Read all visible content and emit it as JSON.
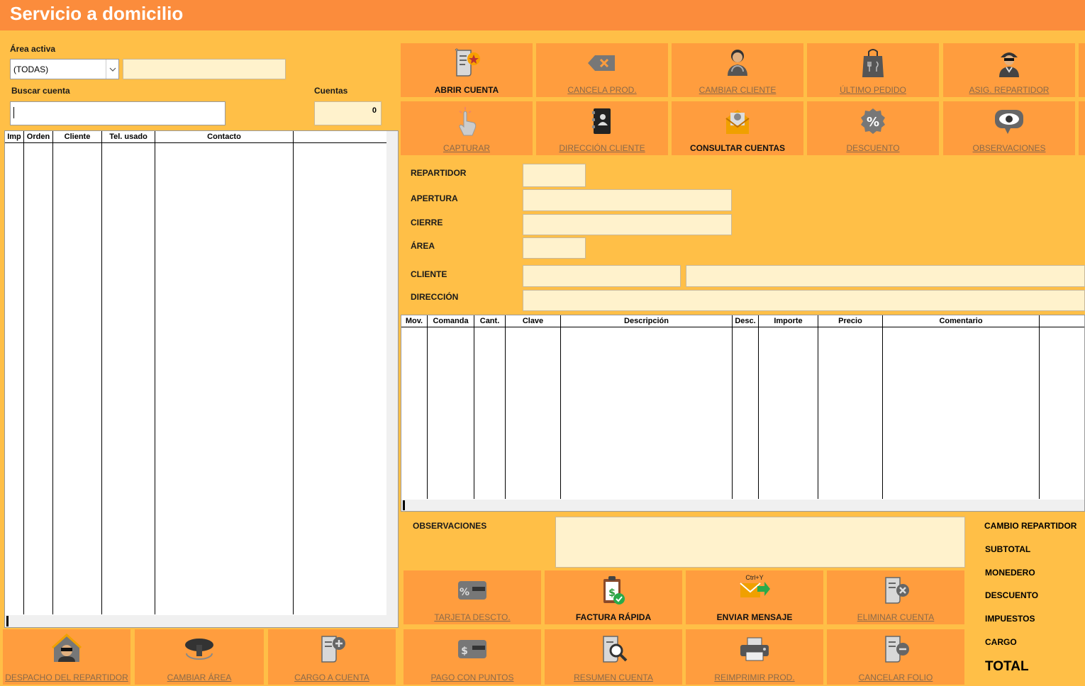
{
  "window": {
    "title": "Servicio a domicilio"
  },
  "left": {
    "area_label": "Área activa",
    "area_select": "(TODAS)",
    "buscar_label": "Buscar cuenta",
    "cuentas_label": "Cuentas",
    "cuentas_value": "0",
    "columns": [
      "Imp",
      "Orden",
      "Cliente",
      "Tel. usado",
      "Contacto"
    ]
  },
  "toolbar": [
    {
      "label": "ABRIR CUENTA",
      "icon": "open-account-icon",
      "enabled": true
    },
    {
      "label": "CANCELA PROD.",
      "icon": "backspace-icon",
      "enabled": false
    },
    {
      "label": "CAMBIAR CLIENTE",
      "icon": "change-client-icon",
      "enabled": false
    },
    {
      "label": "ÚLTIMO PEDIDO",
      "icon": "shopping-bag-icon",
      "enabled": false
    },
    {
      "label": "ASIG. REPARTIDOR",
      "icon": "delivery-person-icon",
      "enabled": false
    },
    {
      "label": "CAPTURAR",
      "icon": "tap-hand-icon",
      "enabled": false
    },
    {
      "label": "DIRECCIÓN CLIENTE",
      "icon": "address-book-icon",
      "enabled": false
    },
    {
      "label": "CONSULTAR CUENTAS",
      "icon": "mail-envelope-icon",
      "enabled": true
    },
    {
      "label": "DESCUENTO",
      "icon": "percent-badge-icon",
      "enabled": false
    },
    {
      "label": "OBSERVACIONES",
      "icon": "eye-bubble-icon",
      "enabled": false
    }
  ],
  "form": {
    "repartidor": "REPARTIDOR",
    "apertura": "APERTURA",
    "cierre": "CIERRE",
    "area": "ÁREA",
    "cliente": "CLIENTE",
    "direccion": "DIRECCIÓN"
  },
  "detail_columns": [
    "Mov.",
    "Comanda",
    "Cant.",
    "Clave",
    "Descripción",
    "Desc.",
    "Importe",
    "Precio",
    "Comentario"
  ],
  "observaciones_label": "OBSERVACIONES",
  "totals": [
    "CAMBIO REPARTIDOR",
    "SUBTOTAL",
    "MONEDERO",
    "DESCUENTO",
    "IMPUESTOS",
    "CARGO"
  ],
  "total_label": "TOTAL",
  "mid_buttons": [
    {
      "label": "TARJETA DESCTO.",
      "icon": "discount-card-icon",
      "enabled": false
    },
    {
      "label": "FACTURA RÁPIDA",
      "icon": "invoice-clipboard-icon",
      "enabled": true
    },
    {
      "label": "ENVIAR MENSAJE",
      "icon": "send-mail-icon",
      "enabled": true,
      "hint": "Ctrl+Y"
    },
    {
      "label": "ELIMINAR CUENTA",
      "icon": "delete-account-icon",
      "enabled": false
    }
  ],
  "bottom_buttons": [
    {
      "label": "DESPACHO DEL REPARTIDOR",
      "icon": "dispatch-house-icon",
      "enabled": false
    },
    {
      "label": "CAMBIAR ÁREA",
      "icon": "change-area-icon",
      "enabled": false
    },
    {
      "label": "CARGO A CUENTA",
      "icon": "charge-account-icon",
      "enabled": false
    },
    {
      "label": "PAGO CON PUNTOS",
      "icon": "points-card-icon",
      "enabled": false
    },
    {
      "label": "RESUMEN CUENTA",
      "icon": "account-search-icon",
      "enabled": false
    },
    {
      "label": "REIMPRIMIR PROD.",
      "icon": "printer-icon",
      "enabled": false
    },
    {
      "label": "CANCELAR FOLIO",
      "icon": "cancel-folio-icon",
      "enabled": false
    }
  ]
}
